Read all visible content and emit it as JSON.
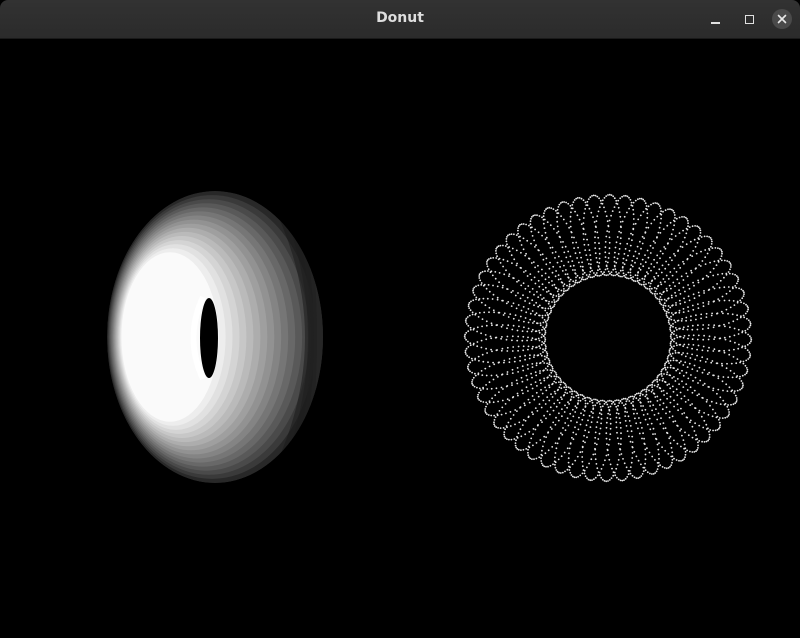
{
  "window": {
    "title": "Donut",
    "controls": [
      "minimize-icon",
      "maximize-icon",
      "close-icon"
    ]
  },
  "scene": {
    "background": "#000000",
    "left_donut": {
      "style": "shaded",
      "shading": "grayscale"
    },
    "right_donut": {
      "style": "point-cloud",
      "color": "#e8e8e8"
    }
  }
}
